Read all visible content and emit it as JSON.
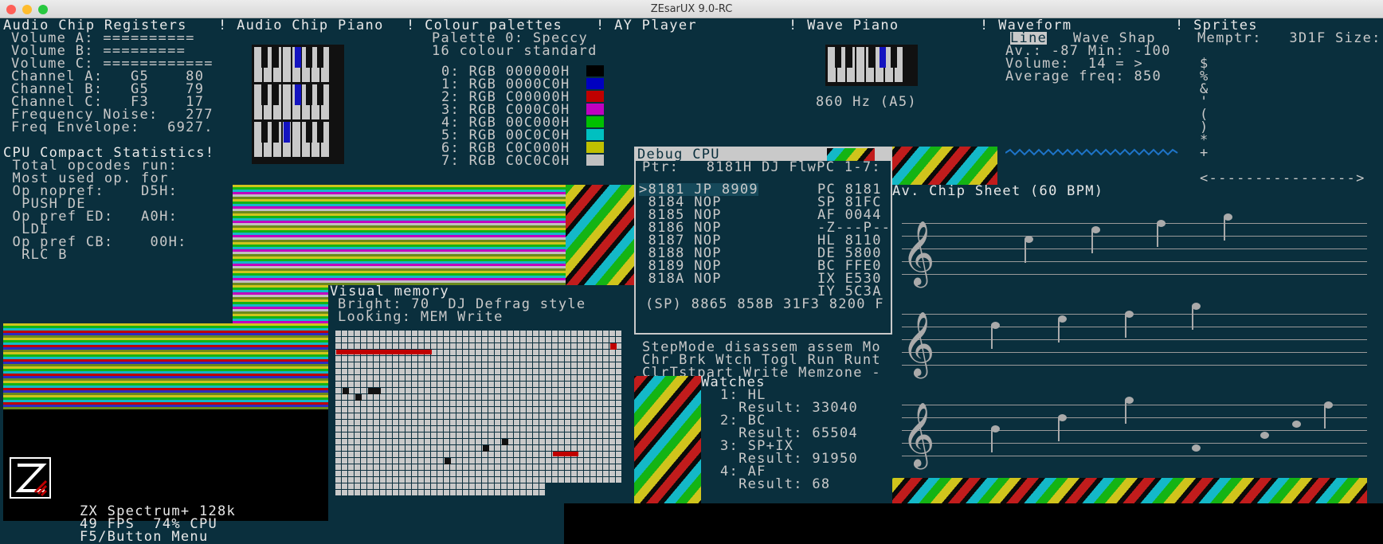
{
  "window": {
    "title": "ZEsarUX 9.0-RC"
  },
  "menubar": [
    "Audio Chip Registers",
    "! Audio Chip Piano",
    "! Colour palettes",
    "! AY Player",
    "! Wave Piano",
    "! Waveform",
    "! Sprites"
  ],
  "audio_regs": [
    "Volume A: ==========",
    "Volume B: =========",
    "Volume C: ============",
    "Channel A:   G5    80",
    "Channel B:   G5    79",
    "Channel C:   F3    17",
    "Frequency Noise:   277",
    "Freq Envelope:   6927."
  ],
  "cpu_stats": [
    "CPU Compact Statistics!",
    " Total opcodes run:",
    " Most used op. for",
    " Op nopref:    D5H:",
    "  PUSH DE",
    " Op pref ED:   A0H:",
    "  LDI",
    " Op pref CB:    00H:",
    "  RLC B"
  ],
  "palette": {
    "title": "Palette 0: Speccy",
    "subtitle": "16 colour standard",
    "entries": [
      "0: RGB 000000H",
      "1: RGB 0000C0H",
      "2: RGB C00000H",
      "3: RGB C000C0H",
      "4: RGB 00C000H",
      "5: RGB 00C0C0H",
      "6: RGB C0C000H",
      "7: RGB C0C0C0H"
    ],
    "colors": [
      "#000000",
      "#0000c0",
      "#c00000",
      "#c000c0",
      "#00c000",
      "#00c0c0",
      "#c0c000",
      "#c0c0c0"
    ]
  },
  "wave_piano": {
    "freq": "860 Hz (A5)"
  },
  "waveform": {
    "mode": "Line",
    "shape": "Wave Shap",
    "av": "Av.: -87 Min: -100",
    "volume": "Volume:  14 = >",
    "avg": "Average freq: 850"
  },
  "sprites": {
    "header": "Memptr:   3D1F Size:",
    "glyphs": [
      "$",
      "%",
      "&",
      "'",
      "(",
      ")",
      "*",
      "+"
    ],
    "footer": "<---------------->"
  },
  "debug": {
    "title": "Debug CPU",
    "ptr": "Ptr:   8181H DJ FlwPC 1-7:",
    "lines": [
      ">8181 JP 8909",
      " 8184 NOP",
      " 8185 NOP",
      " 8186 NOP",
      " 8187 NOP",
      " 8188 NOP",
      " 8189 NOP",
      " 818A NOP"
    ],
    "regs": [
      "PC 8181",
      "SP 81FC",
      "AF 0044",
      "-Z---P--",
      "HL 8110",
      "DE 5800",
      "BC FFE0",
      "IX E530",
      "IY 5C3A"
    ],
    "stack": "(SP) 8865 858B 31F3 8200 F",
    "cmd1": "StepMode disassem assem Mo",
    "cmd2": "Chr Brk Wtch Togl Run Runt",
    "cmd3": "ClrTstpart Write Memzone -"
  },
  "chip_sheet": {
    "title": "Av. Chip Sheet (60 BPM)"
  },
  "visual_memory": {
    "title": "Visual memory",
    "bright": "Bright: 70  DJ Defrag style",
    "looking": "Looking: MEM Write"
  },
  "watches": {
    "title": "Watches",
    "items": [
      "1: HL",
      "  Result: 33040",
      "2: BC",
      "  Result: 65504",
      "3: SP+IX",
      "  Result: 91950",
      "4: AF",
      "  Result: 68"
    ]
  },
  "status": [
    "ZX Spectrum+ 128k",
    "49 FPS  74% CPU",
    "F5/Button Menu"
  ]
}
